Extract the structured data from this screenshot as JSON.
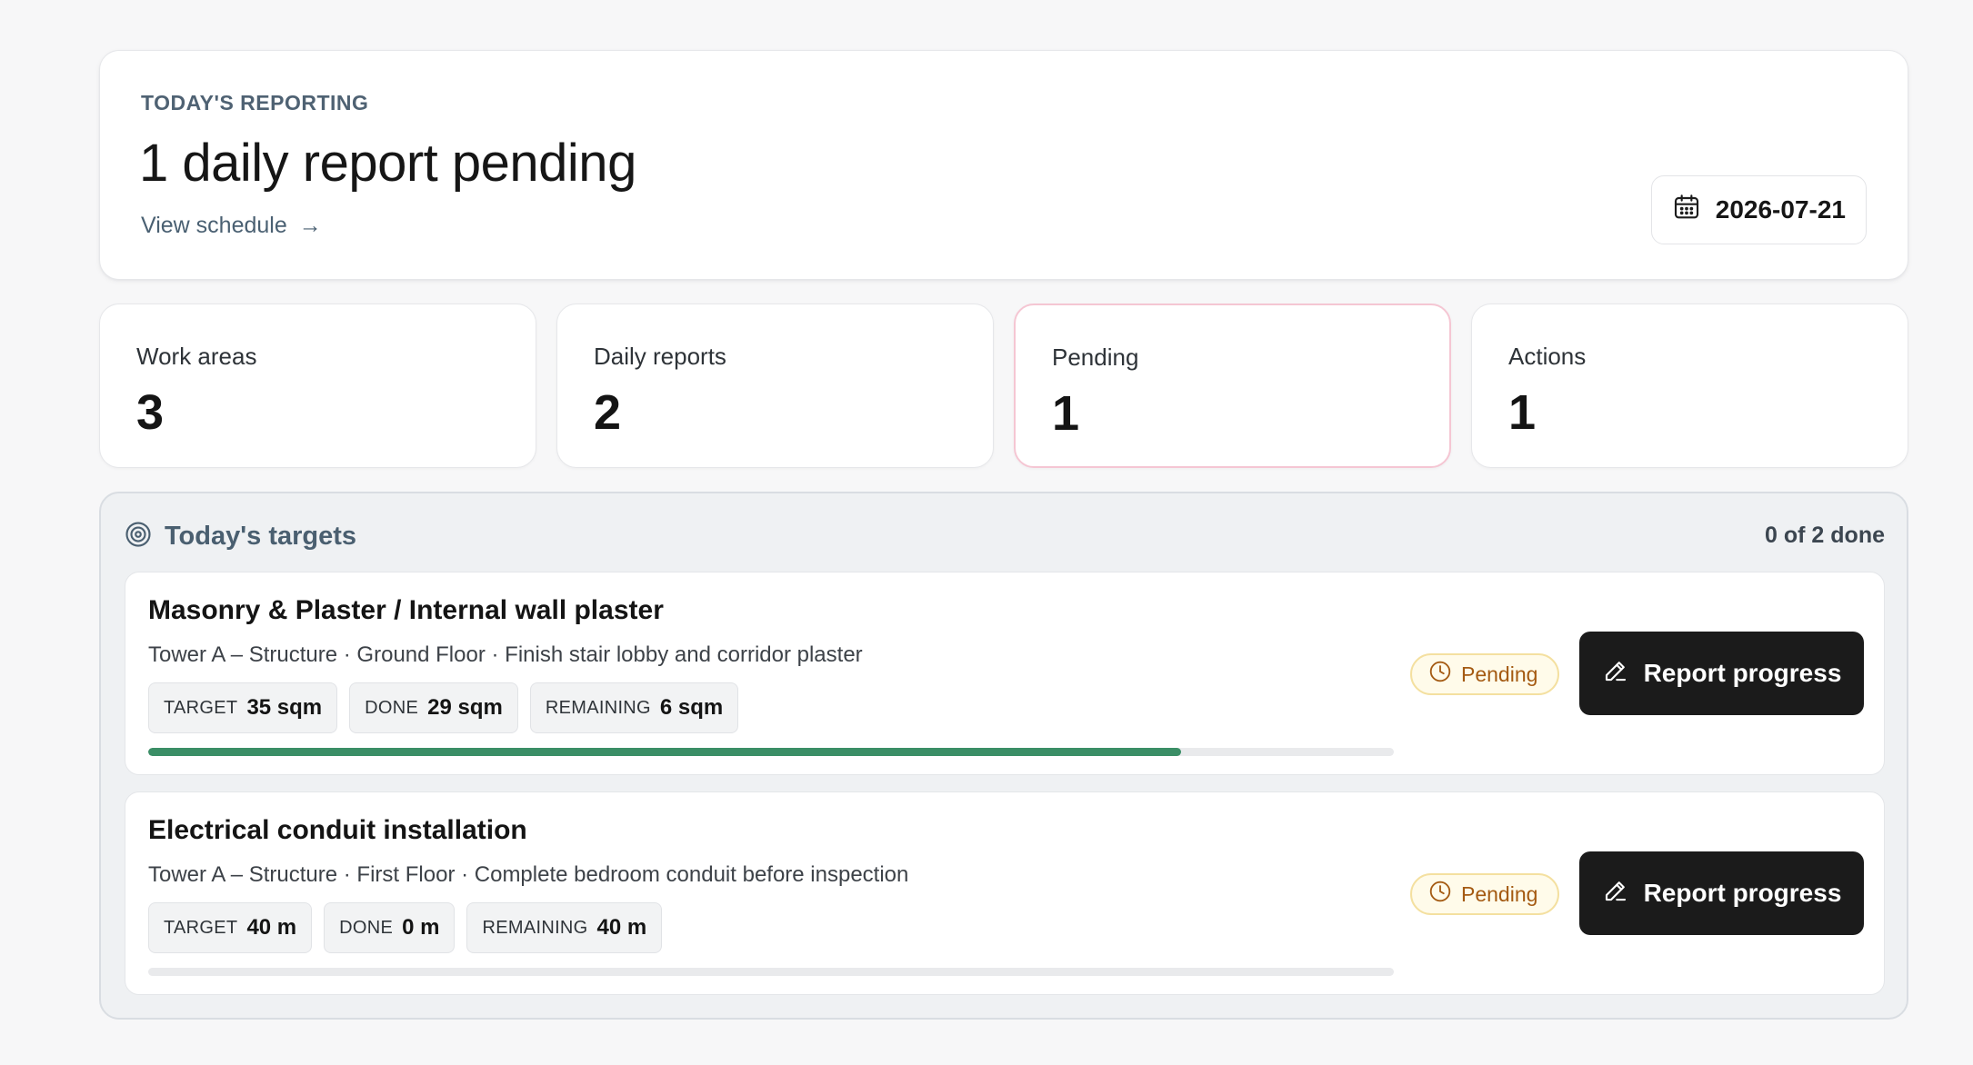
{
  "header": {
    "eyebrow": "TODAY'S REPORTING",
    "title": "1 daily report pending",
    "link_label": "View schedule",
    "link_arrow": "→",
    "date": "2026-07-21"
  },
  "stats": [
    {
      "label": "Work areas",
      "value": "3"
    },
    {
      "label": "Daily reports",
      "value": "2"
    },
    {
      "label": "Pending",
      "value": "1",
      "highlight": true
    },
    {
      "label": "Actions",
      "value": "1"
    }
  ],
  "targets": {
    "title": "Today's targets",
    "count_label": "0 of 2 done",
    "items": [
      {
        "title": "Masonry & Plaster / Internal wall plaster",
        "subtitle": "Tower A – Structure · Ground Floor · Finish stair lobby and corridor plaster",
        "target_key": "TARGET",
        "target_value": "35 sqm",
        "done_key": "DONE",
        "done_value": "29 sqm",
        "remaining_key": "REMAINING",
        "remaining_value": "6 sqm",
        "progress": 0.829,
        "status": "Pending",
        "action_label": "Report progress"
      },
      {
        "title": "Electrical conduit installation",
        "subtitle": "Tower A – Structure · First Floor · Complete bedroom conduit before inspection",
        "target_key": "TARGET",
        "target_value": "40 m",
        "done_key": "DONE",
        "done_value": "0 m",
        "remaining_key": "REMAINING",
        "remaining_value": "40 m",
        "progress": 0,
        "status": "Pending",
        "action_label": "Report progress"
      }
    ]
  },
  "icons": {
    "date": "calendar-icon",
    "targets": "target-icon",
    "status": "clock-icon",
    "action": "pencil-icon"
  },
  "colors": {
    "progress_fill": "#3b8e66",
    "pending_text": "#a45a12",
    "pending_bg": "#fffbea",
    "button_bg": "#1b1b1b",
    "alert_border": "#f5c6d3"
  }
}
